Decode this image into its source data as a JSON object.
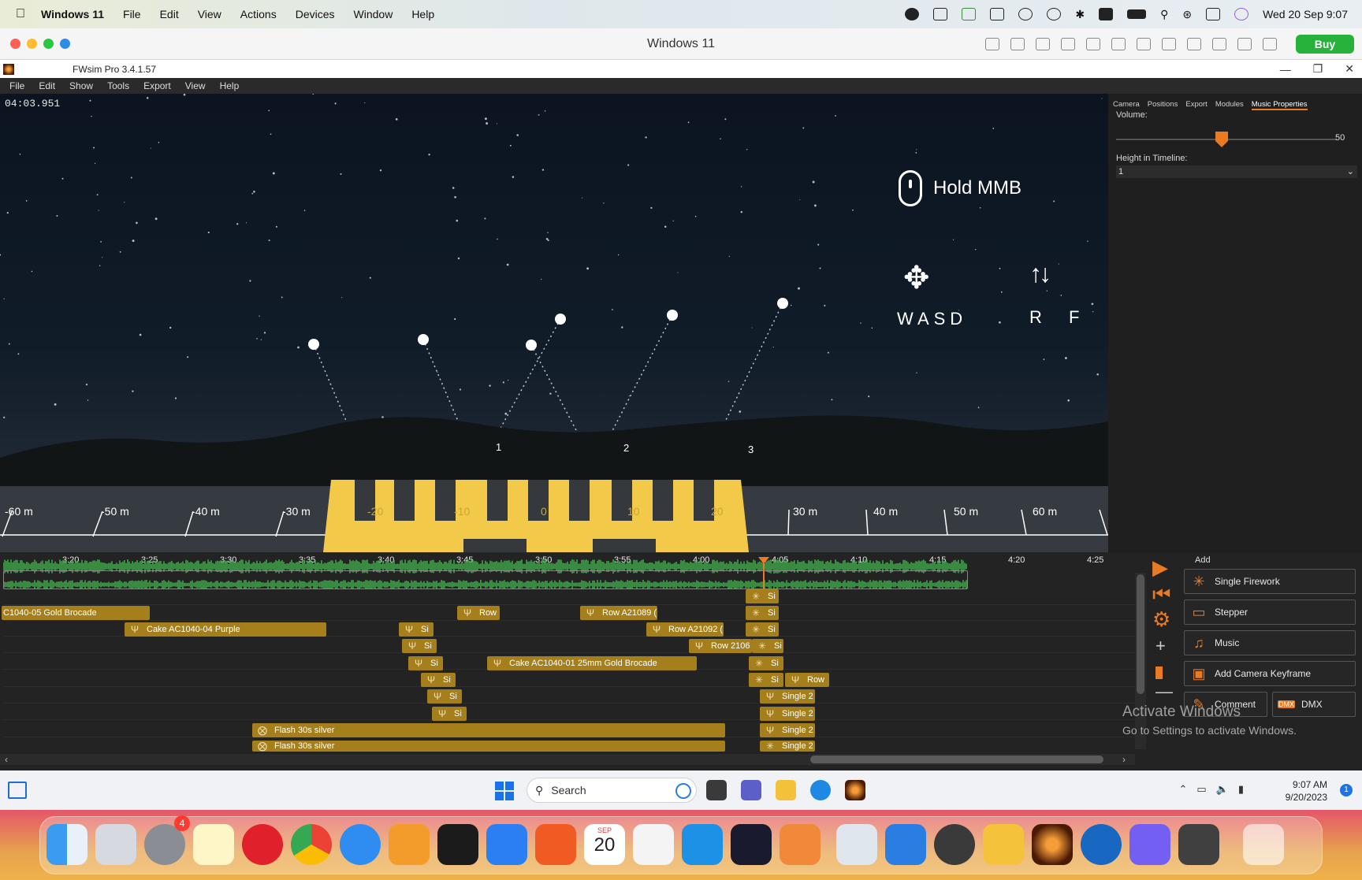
{
  "mac_menubar": {
    "app_name": "Windows 11",
    "items": [
      "File",
      "Edit",
      "View",
      "Actions",
      "Devices",
      "Window",
      "Help"
    ],
    "datetime": "Wed 20 Sep  9:07",
    "status_icons": [
      "shield-icon",
      "a-icon",
      "download-icon",
      "screen-icon",
      "cloud-icon",
      "play-icon",
      "bluetooth-icon",
      "keyboard-a-icon",
      "battery-icon",
      "search-icon",
      "wifi-icon",
      "control-center-icon",
      "siri-icon"
    ]
  },
  "vm_window": {
    "title": "Windows 11",
    "buy_label": "Buy"
  },
  "app": {
    "title": "FWsim Pro 3.4.1.57",
    "menu": [
      "File",
      "Edit",
      "Show",
      "Tools",
      "Export",
      "View",
      "Help"
    ],
    "timecode": "04:03.951"
  },
  "viewport": {
    "hold_mmb": "Hold MMB",
    "wasd": "WASD",
    "rf": "R F",
    "position_labels": [
      "1",
      "2",
      "3"
    ],
    "distance_labels": [
      "-60 m",
      "-50 m",
      "-40 m",
      "-30 m",
      "-20",
      "-10",
      "0",
      "10",
      "20",
      "30 m",
      "40 m",
      "50 m",
      "60 m"
    ]
  },
  "side_panel": {
    "tabs": [
      "Camera",
      "Positions",
      "Export",
      "Modules",
      "Music Properties"
    ],
    "active_tab": "Music Properties",
    "volume_label": "Volume:",
    "volume_value": "50",
    "volume_level": 0.5,
    "height_label": "Height in Timeline:",
    "height_value": "1"
  },
  "timeline": {
    "ruler": [
      "3:20",
      "3:25",
      "3:30",
      "3:35",
      "3:40",
      "3:45",
      "3:50",
      "3:55",
      "4:00",
      "4:05",
      "4:10",
      "4:15",
      "4:20",
      "4:25"
    ],
    "events": [
      {
        "label": "C1040-05 Gold Brocade",
        "icon": "",
        "track": 0
      },
      {
        "label": "Row",
        "icon": "fan-icon",
        "track": 0
      },
      {
        "label": "Row A21089 (",
        "icon": "fan-icon",
        "track": 0
      },
      {
        "label": "Si",
        "icon": "burst-icon",
        "track": -1
      },
      {
        "label": "Si",
        "icon": "burst-icon",
        "track": 0
      },
      {
        "label": "Cake AC1040-04 Purple",
        "icon": "fan-icon",
        "track": 1
      },
      {
        "label": "Si",
        "icon": "fan-icon",
        "track": 1
      },
      {
        "label": "Row A21092 (",
        "icon": "fan-icon",
        "track": 1
      },
      {
        "label": "Si",
        "icon": "burst-icon",
        "track": 1
      },
      {
        "label": "Si",
        "icon": "fan-icon",
        "track": 2
      },
      {
        "label": "Row 2106",
        "icon": "fan-icon",
        "track": 2
      },
      {
        "label": "Si",
        "icon": "burst-icon",
        "track": 2
      },
      {
        "label": "Si",
        "icon": "fan-icon",
        "track": 3
      },
      {
        "label": "Cake AC1040-01 25mm Gold Brocade",
        "icon": "fan-icon",
        "track": 3
      },
      {
        "label": "Si",
        "icon": "burst-icon",
        "track": 3
      },
      {
        "label": "Si",
        "icon": "fan-icon",
        "track": 4
      },
      {
        "label": "Si",
        "icon": "burst-icon",
        "track": 4
      },
      {
        "label": "Row",
        "icon": "fan-icon",
        "track": 4
      },
      {
        "label": "Si",
        "icon": "fan-icon",
        "track": 5
      },
      {
        "label": "Single 2",
        "icon": "fan-icon",
        "track": 5
      },
      {
        "label": "Si",
        "icon": "fan-icon",
        "track": 6
      },
      {
        "label": "Single 2",
        "icon": "fan-icon",
        "track": 6
      },
      {
        "label": "Flash 30s silver",
        "icon": "flash-icon",
        "track": 7
      },
      {
        "label": "Single 2",
        "icon": "fan-icon",
        "track": 7
      },
      {
        "label": "Flash 30s silver",
        "icon": "flash-icon",
        "track": 8
      },
      {
        "label": "Single 2",
        "icon": "burst-icon",
        "track": 8
      }
    ]
  },
  "add_panel": {
    "title": "Add",
    "buttons": [
      {
        "label": "Single Firework",
        "icon": "firework-icon"
      },
      {
        "label": "Stepper",
        "icon": "stepper-icon"
      },
      {
        "label": "Music",
        "icon": "music-icon"
      },
      {
        "label": "Add Camera Keyframe",
        "icon": "camera-keyframe-icon"
      },
      {
        "label": "Comment",
        "icon": "comment-icon"
      },
      {
        "label": "DMX",
        "icon": "dmx-icon"
      }
    ]
  },
  "watermark": {
    "line1": "Activate Windows",
    "line2": "Go to Settings to activate Windows."
  },
  "taskbar": {
    "search_placeholder": "Search",
    "time": "9:07 AM",
    "date": "9/20/2023",
    "notification_count": "1"
  },
  "dock": {
    "badge": "4",
    "calendar_month": "SEP",
    "calendar_day": "20",
    "apps": [
      "finder",
      "launchpad",
      "system-settings",
      "notes",
      "opera",
      "chrome",
      "safari",
      "pages",
      "terminal",
      "app-store",
      "brave",
      "calendar",
      "slack",
      "docker",
      "phpstorm",
      "cloud-app",
      "remote-desktop",
      "windows-11",
      "keychain",
      "folder",
      "fwsim",
      "surfshark",
      "viber",
      "calculator",
      "trash"
    ]
  },
  "colors": {
    "accent": "#e87b24",
    "event_fill": "#a47f1c",
    "waveform": "#3fae4a",
    "buy": "#27b33b"
  }
}
